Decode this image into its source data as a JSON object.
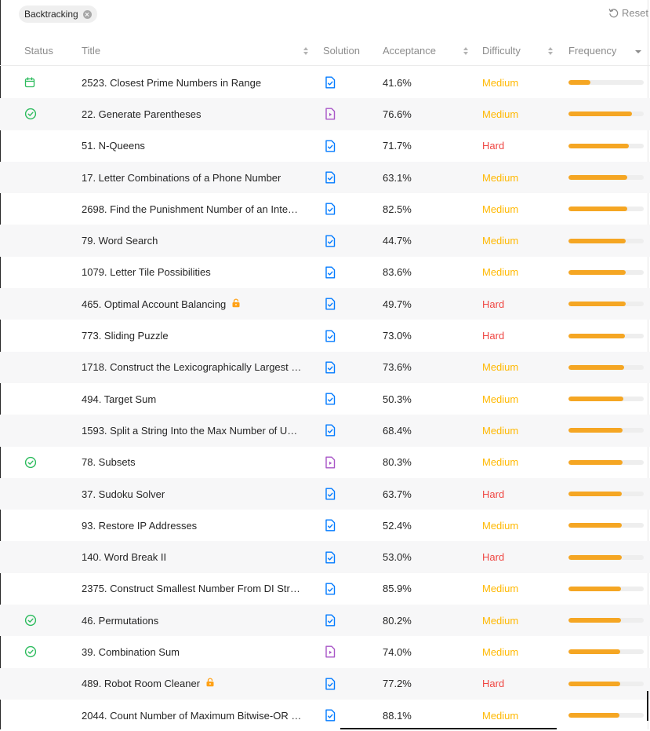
{
  "filter": {
    "chip_label": "Backtracking",
    "reset_label": "Reset"
  },
  "columns": {
    "status": "Status",
    "title": "Title",
    "solution": "Solution",
    "acceptance": "Acceptance",
    "difficulty": "Difficulty",
    "frequency": "Frequency"
  },
  "colors": {
    "medium": "#ffb800",
    "hard": "#ef4743",
    "solved": "#2cbb5d",
    "daily": "#2cbb5d",
    "solution_article": "#007aff",
    "solution_video": "#a855c7",
    "frequency_bar": "#f5a623",
    "lock": "#ffa116"
  },
  "rows": [
    {
      "status": "calendar-icon",
      "title": "2523. Closest Prime Numbers in Range",
      "locked": false,
      "solution": "article",
      "acceptance": "41.6%",
      "difficulty": "Medium",
      "frequency": 0.29
    },
    {
      "status": "solved-icon",
      "title": "22. Generate Parentheses",
      "locked": false,
      "solution": "video",
      "acceptance": "76.6%",
      "difficulty": "Medium",
      "frequency": 0.84
    },
    {
      "status": "",
      "title": "51. N-Queens",
      "locked": false,
      "solution": "article",
      "acceptance": "71.7%",
      "difficulty": "Hard",
      "frequency": 0.8
    },
    {
      "status": "",
      "title": "17. Letter Combinations of a Phone Number",
      "locked": false,
      "solution": "article",
      "acceptance": "63.1%",
      "difficulty": "Medium",
      "frequency": 0.78
    },
    {
      "status": "",
      "title": "2698. Find the Punishment Number of an Inte…",
      "locked": false,
      "solution": "article",
      "acceptance": "82.5%",
      "difficulty": "Medium",
      "frequency": 0.78
    },
    {
      "status": "",
      "title": "79. Word Search",
      "locked": false,
      "solution": "article",
      "acceptance": "44.7%",
      "difficulty": "Medium",
      "frequency": 0.76
    },
    {
      "status": "",
      "title": "1079. Letter Tile Possibilities",
      "locked": false,
      "solution": "article",
      "acceptance": "83.6%",
      "difficulty": "Medium",
      "frequency": 0.76
    },
    {
      "status": "",
      "title": "465. Optimal Account Balancing",
      "locked": true,
      "solution": "article",
      "acceptance": "49.7%",
      "difficulty": "Hard",
      "frequency": 0.76
    },
    {
      "status": "",
      "title": "773. Sliding Puzzle",
      "locked": false,
      "solution": "article",
      "acceptance": "73.0%",
      "difficulty": "Hard",
      "frequency": 0.75
    },
    {
      "status": "",
      "title": "1718. Construct the Lexicographically Largest …",
      "locked": false,
      "solution": "article",
      "acceptance": "73.6%",
      "difficulty": "Medium",
      "frequency": 0.74
    },
    {
      "status": "",
      "title": "494. Target Sum",
      "locked": false,
      "solution": "article",
      "acceptance": "50.3%",
      "difficulty": "Medium",
      "frequency": 0.73
    },
    {
      "status": "",
      "title": "1593. Split a String Into the Max Number of U…",
      "locked": false,
      "solution": "article",
      "acceptance": "68.4%",
      "difficulty": "Medium",
      "frequency": 0.72
    },
    {
      "status": "solved-icon",
      "title": "78. Subsets",
      "locked": false,
      "solution": "video",
      "acceptance": "80.3%",
      "difficulty": "Medium",
      "frequency": 0.72
    },
    {
      "status": "",
      "title": "37. Sudoku Solver",
      "locked": false,
      "solution": "article",
      "acceptance": "63.7%",
      "difficulty": "Hard",
      "frequency": 0.71
    },
    {
      "status": "",
      "title": "93. Restore IP Addresses",
      "locked": false,
      "solution": "article",
      "acceptance": "52.4%",
      "difficulty": "Medium",
      "frequency": 0.71
    },
    {
      "status": "",
      "title": "140. Word Break II",
      "locked": false,
      "solution": "article",
      "acceptance": "53.0%",
      "difficulty": "Hard",
      "frequency": 0.71
    },
    {
      "status": "",
      "title": "2375. Construct Smallest Number From DI Str…",
      "locked": false,
      "solution": "article",
      "acceptance": "85.9%",
      "difficulty": "Medium",
      "frequency": 0.7
    },
    {
      "status": "solved-icon",
      "title": "46. Permutations",
      "locked": false,
      "solution": "article",
      "acceptance": "80.2%",
      "difficulty": "Medium",
      "frequency": 0.7
    },
    {
      "status": "solved-icon",
      "title": "39. Combination Sum",
      "locked": false,
      "solution": "video",
      "acceptance": "74.0%",
      "difficulty": "Medium",
      "frequency": 0.69
    },
    {
      "status": "",
      "title": "489. Robot Room Cleaner",
      "locked": true,
      "solution": "article",
      "acceptance": "77.2%",
      "difficulty": "Hard",
      "frequency": 0.69
    },
    {
      "status": "",
      "title": "2044. Count Number of Maximum Bitwise-OR …",
      "locked": false,
      "solution": "article",
      "acceptance": "88.1%",
      "difficulty": "Medium",
      "frequency": 0.68
    }
  ]
}
